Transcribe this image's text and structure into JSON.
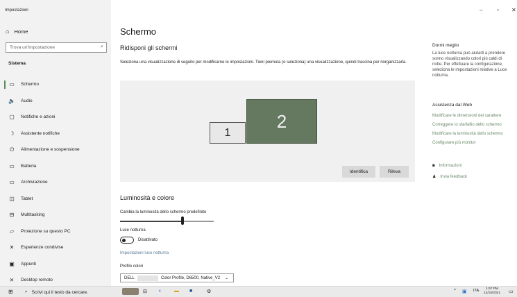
{
  "window": {
    "title": "Impostazioni",
    "minimize": "–",
    "maximize": "▫",
    "close": "✕"
  },
  "sidebar": {
    "home": "Home",
    "search_placeholder": "Trova un'impostazione",
    "section": "Sistema",
    "items": [
      {
        "label": "Schermo",
        "icon": "monitor-icon",
        "glyph": "▭"
      },
      {
        "label": "Audio",
        "icon": "speaker-icon",
        "glyph": "🔈"
      },
      {
        "label": "Notifiche e azioni",
        "icon": "notification-icon",
        "glyph": "▢"
      },
      {
        "label": "Assistente notifiche",
        "icon": "moon-icon",
        "glyph": "☽"
      },
      {
        "label": "Alimentazione e sospensione",
        "icon": "power-icon",
        "glyph": "⏻"
      },
      {
        "label": "Batteria",
        "icon": "battery-icon",
        "glyph": "▭"
      },
      {
        "label": "Archiviazione",
        "icon": "storage-icon",
        "glyph": "▭"
      },
      {
        "label": "Tablet",
        "icon": "tablet-icon",
        "glyph": "◫"
      },
      {
        "label": "Multitasking",
        "icon": "multitasking-icon",
        "glyph": "⊟"
      },
      {
        "label": "Proiezione su questo PC",
        "icon": "projection-icon",
        "glyph": "▱"
      },
      {
        "label": "Esperienze condivise",
        "icon": "shared-icon",
        "glyph": "✕"
      },
      {
        "label": "Appunti",
        "icon": "clipboard-icon",
        "glyph": "▣"
      },
      {
        "label": "Desktop remoto",
        "icon": "remote-desktop-icon",
        "glyph": "⨯"
      }
    ]
  },
  "main": {
    "title": "Schermo",
    "arrange_heading": "Ridisponi gli schermi",
    "arrange_desc": "Seleziona una visualizzazione di seguito per modificarne le impostazioni. Tieni premuta (o seleziona) una visualizzazione, quindi trascina per riorganizzarla.",
    "monitor1": "1",
    "monitor2": "2",
    "identify_button": "Identifica",
    "detect_button": "Rileva",
    "brightness_heading": "Luminosità e colore",
    "brightness_label": "Cambia la luminosità dello schermo predefinito",
    "brightness_value": 0.65,
    "night_light_label": "Luce notturna",
    "night_light_state": "Disattivato",
    "night_light_settings_link": "Impostazioni luce notturna",
    "color_profile_label": "Profilo colori",
    "color_profile_value_prefix": "DELL",
    "color_profile_value_suffix": "Color Profile, D6500, Native_V2"
  },
  "right_panel": {
    "sleep_title": "Dormi meglio",
    "sleep_text": "La luce notturna può aiutarti a prendere sonno visualizzando colori più caldi di notte. Per effettuare la configurazione, seleziona le impostazioni relative a Luce notturna.",
    "web_help_title": "Assistenza dal Web",
    "links": [
      "Modificare le dimensioni del carattere",
      "Correggere lo sfarfallio dello schermo",
      "Modificare la luminosità dello schermo",
      "Configurare più monitor"
    ],
    "info": "Informazioni",
    "feedback": "Invia feedback"
  },
  "taskbar": {
    "search_placeholder": "Scrivi qui il testo da cercare.",
    "lang": "ITA",
    "time": "1:57 PM",
    "date": "12/15/2021"
  },
  "colors": {
    "accent": "#64795f",
    "link": "#6a8a6a"
  }
}
